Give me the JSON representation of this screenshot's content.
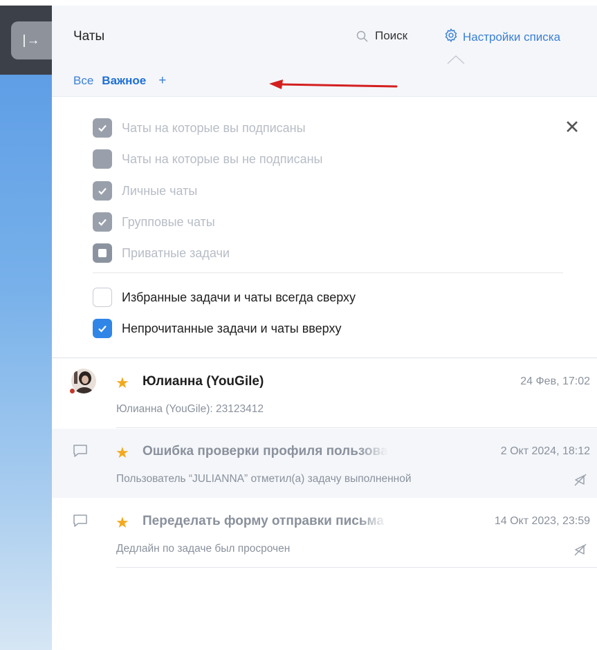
{
  "header": {
    "title": "Чаты",
    "search_label": "Поиск",
    "settings_label": "Настройки списка"
  },
  "tabs": [
    {
      "label": "Все"
    },
    {
      "label": "Важное",
      "active": true
    },
    {
      "label": "+"
    }
  ],
  "filters": {
    "items": [
      {
        "label": "Чаты на которые вы подписаны",
        "state": "checked",
        "disabled": true
      },
      {
        "label": "Чаты на которые вы не подписаны",
        "state": "unchecked",
        "disabled": true
      },
      {
        "label": "Личные чаты",
        "state": "checked",
        "disabled": true
      },
      {
        "label": "Групповые чаты",
        "state": "checked",
        "disabled": true
      },
      {
        "label": "Приватные задачи",
        "state": "indeterminate",
        "disabled": true
      }
    ],
    "options": [
      {
        "label": "Избранные задачи и чаты всегда сверху",
        "state": "unchecked"
      },
      {
        "label": "Непрочитанные задачи и чаты вверху",
        "state": "checked"
      }
    ]
  },
  "chats": [
    {
      "title": "Юлианна (YouGile)",
      "time": "24 Фев, 17:02",
      "preview": "Юлианна (YouGile): 23123412",
      "starred": true
    },
    {
      "title": "Ошибка проверки профиля пользователя",
      "time": "2 Окт 2024, 18:12",
      "preview": "Пользователь “JULIANNA” отметил(а) задачу выполненной",
      "starred": true,
      "muted": true
    },
    {
      "title": "Переделать форму отправки письма",
      "time": "14 Окт 2023, 23:59",
      "preview": "Дедлайн по задаче был просрочен",
      "starred": true,
      "muted": true
    }
  ],
  "colors": {
    "accent": "#1f6fd6",
    "star": "#f2a91c",
    "annotation_arrow": "#d41f1f"
  },
  "icons": {
    "collapse": "sidebar-expand-icon",
    "search": "search-icon",
    "settings": "gear-icon",
    "close": "close-icon",
    "chat": "chat-bubble-icon",
    "mute": "mute-icon",
    "star": "star-icon"
  }
}
